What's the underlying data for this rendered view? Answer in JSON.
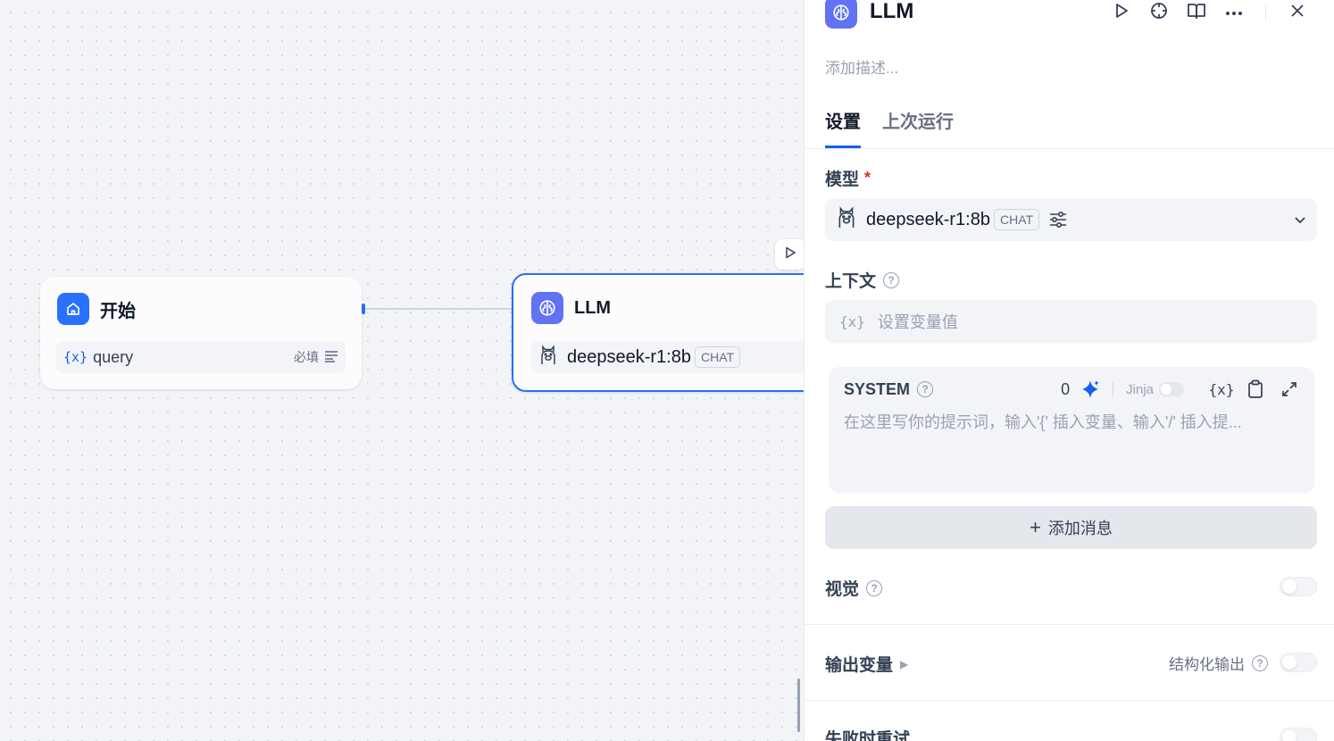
{
  "canvas": {
    "start_node": {
      "title": "开始",
      "var_glyph": "{x}",
      "variable": "query",
      "required": "必填"
    },
    "llm_node": {
      "title": "LLM",
      "model": "deepseek-r1:8b",
      "mode_tag": "CHAT"
    }
  },
  "panel": {
    "title": "LLM",
    "description_placeholder": "添加描述...",
    "tabs": [
      {
        "label": "设置",
        "active": true
      },
      {
        "label": "上次运行",
        "active": false
      }
    ],
    "model_label": "模型",
    "required_mark": "*",
    "model": {
      "name": "deepseek-r1:8b",
      "mode_tag": "CHAT"
    },
    "context_label": "上下文",
    "context_glyph": "{x}",
    "context_placeholder": "设置变量值",
    "system": {
      "title": "SYSTEM",
      "token_count": "0",
      "jinja_label": "Jinja",
      "var_glyph": "{x}",
      "placeholder": "在这里写你的提示词，输入'{' 插入变量、输入'/' 插入提..."
    },
    "add_message": {
      "plus": "+",
      "label": "添加消息"
    },
    "vision_label": "视觉",
    "output_vars_label": "输出变量",
    "structured_output_label": "结构化输出",
    "retry_label": "失败时重试"
  },
  "colors": {
    "accent": "#155eef",
    "start_icon_bg": "#2970ff",
    "llm_icon_bg": "#6172f3",
    "selected_border": "#296dff"
  }
}
